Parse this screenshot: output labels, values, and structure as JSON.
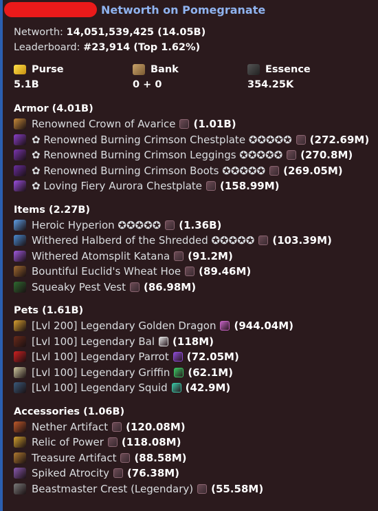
{
  "header": {
    "title": "Networth on Pomegranate"
  },
  "summary": {
    "networth_label": "Networth:",
    "networth_value": "14,051,539,425 (14.05B)",
    "leaderboard_label": "Leaderboard:",
    "leaderboard_value": "#23,914 (Top 1.62%)"
  },
  "stats": [
    {
      "label": "Purse",
      "value": "5.1B",
      "icon": "gold-icon"
    },
    {
      "label": "Bank",
      "value": "0 + 0",
      "icon": "bank-icon"
    },
    {
      "label": "Essence",
      "value": "354.25K",
      "icon": "essence-icon"
    }
  ],
  "sections": [
    {
      "title": "Armor (4.01B)",
      "items": [
        {
          "name": "Renowned Crown of Avarice",
          "price": "(1.01B)",
          "color": "#c78a3a",
          "rock": true
        },
        {
          "name": "✿ Renowned Burning Crimson Chestplate ✪✪✪✪✪",
          "price": "(272.69M)",
          "color": "#8a3fc9",
          "rock": true
        },
        {
          "name": "✿ Renowned Burning Crimson Leggings ✪✪✪✪✪",
          "price": "(270.8M)",
          "color": "#7a35b0",
          "rock": true
        },
        {
          "name": "✿ Renowned Burning Crimson Boots ✪✪✪✪✪",
          "price": "(269.05M)",
          "color": "#6a2ea0",
          "rock": true
        },
        {
          "name": "✿ Loving Fiery Aurora Chestplate",
          "price": "(158.99M)",
          "color": "#9b4fe0",
          "rock": true
        }
      ]
    },
    {
      "title": "Items (2.27B)",
      "items": [
        {
          "name": "Heroic Hyperion ✪✪✪✪✪",
          "price": "(1.36B)",
          "color": "#5fa0e8",
          "rock": true
        },
        {
          "name": "Withered Halberd of the Shredded ✪✪✪✪✪",
          "price": "(103.39M)",
          "color": "#4a8ad0",
          "rock": true
        },
        {
          "name": "Withered Atomsplit Katana",
          "price": "(91.2M)",
          "color": "#a05ae0",
          "rock": true
        },
        {
          "name": "Bountiful Euclid's Wheat Hoe",
          "price": "(89.46M)",
          "color": "#a06a30",
          "rock": true
        },
        {
          "name": "Squeaky Pest Vest",
          "price": "(86.98M)",
          "color": "#2e6a30",
          "rock": true
        }
      ]
    },
    {
      "title": "Pets (1.61B)",
      "items": [
        {
          "name": "[Lvl 200] Legendary Golden Dragon",
          "price": "(944.04M)",
          "color": "#d8a030",
          "badge": "#c060c0"
        },
        {
          "name": "[Lvl 100] Legendary Bal",
          "price": "(118M)",
          "color": "#6a2a1a",
          "badge": "#e0e0e0"
        },
        {
          "name": "[Lvl 100] Legendary Parrot",
          "price": "(72.05M)",
          "color": "#d02020",
          "badge": "#8a4ad0"
        },
        {
          "name": "[Lvl 100] Legendary Griffin",
          "price": "(62.1M)",
          "color": "#d0c8a0",
          "badge": "#3ac060"
        },
        {
          "name": "[Lvl 100] Legendary Squid",
          "price": "(42.9M)",
          "color": "#3a5a7a",
          "badge": "#3ac0a0"
        }
      ]
    },
    {
      "title": "Accessories (1.06B)",
      "items": [
        {
          "name": "Nether Artifact",
          "price": "(120.08M)",
          "color": "#c05a2a",
          "rock": true
        },
        {
          "name": "Relic of Power",
          "price": "(118.08M)",
          "color": "#d0a030",
          "rock": true
        },
        {
          "name": "Treasure Artifact",
          "price": "(88.58M)",
          "color": "#b07a30",
          "rock": true
        },
        {
          "name": "Spiked Atrocity",
          "price": "(76.38M)",
          "color": "#8a5ab0",
          "rock": true
        },
        {
          "name": "Beastmaster Crest (Legendary)",
          "price": "(55.58M)",
          "color": "#7a7a7a",
          "rock": true
        }
      ]
    }
  ]
}
